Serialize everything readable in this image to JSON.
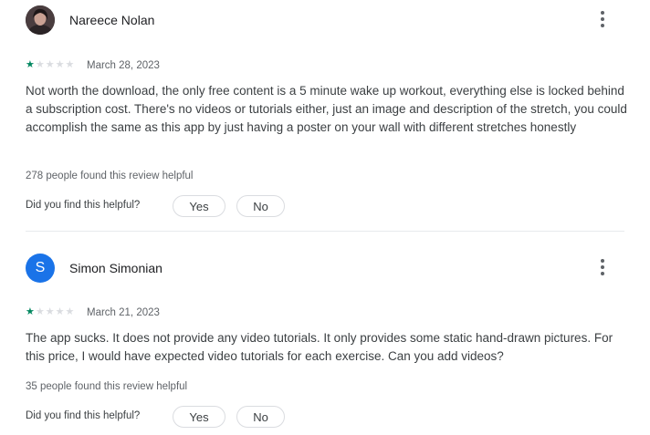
{
  "reviews": [
    {
      "author": "Nareece Nolan",
      "avatar_type": "photo",
      "avatar_letter": "",
      "rating": 1,
      "max_rating": 5,
      "date": "March 28, 2023",
      "text": "Not worth the download, the only free content is a 5 minute wake up workout, everything else is locked behind a subscription cost. There's no videos or tutorials either, just an image and description of the stretch, you could accomplish the same as this app by just having a poster on your wall with different stretches honestly",
      "helpful_count_text": "278 people found this review helpful",
      "question": "Did you find this helpful?",
      "yes_label": "Yes",
      "no_label": "No"
    },
    {
      "author": "Simon Simonian",
      "avatar_type": "letter",
      "avatar_letter": "S",
      "avatar_color": "#1a73e8",
      "rating": 1,
      "max_rating": 5,
      "date": "March 21, 2023",
      "text": "The app sucks. It does not provide any video tutorials. It only provides some static hand-drawn pictures. For this price, I would have expected video tutorials for each exercise. Can you add videos?",
      "helpful_count_text": "35 people found this review helpful",
      "question": "Did you find this helpful?",
      "yes_label": "Yes",
      "no_label": "No"
    }
  ],
  "colors": {
    "star_filled": "#01875f",
    "star_empty": "#dadce0",
    "text_secondary": "#5f6368"
  }
}
